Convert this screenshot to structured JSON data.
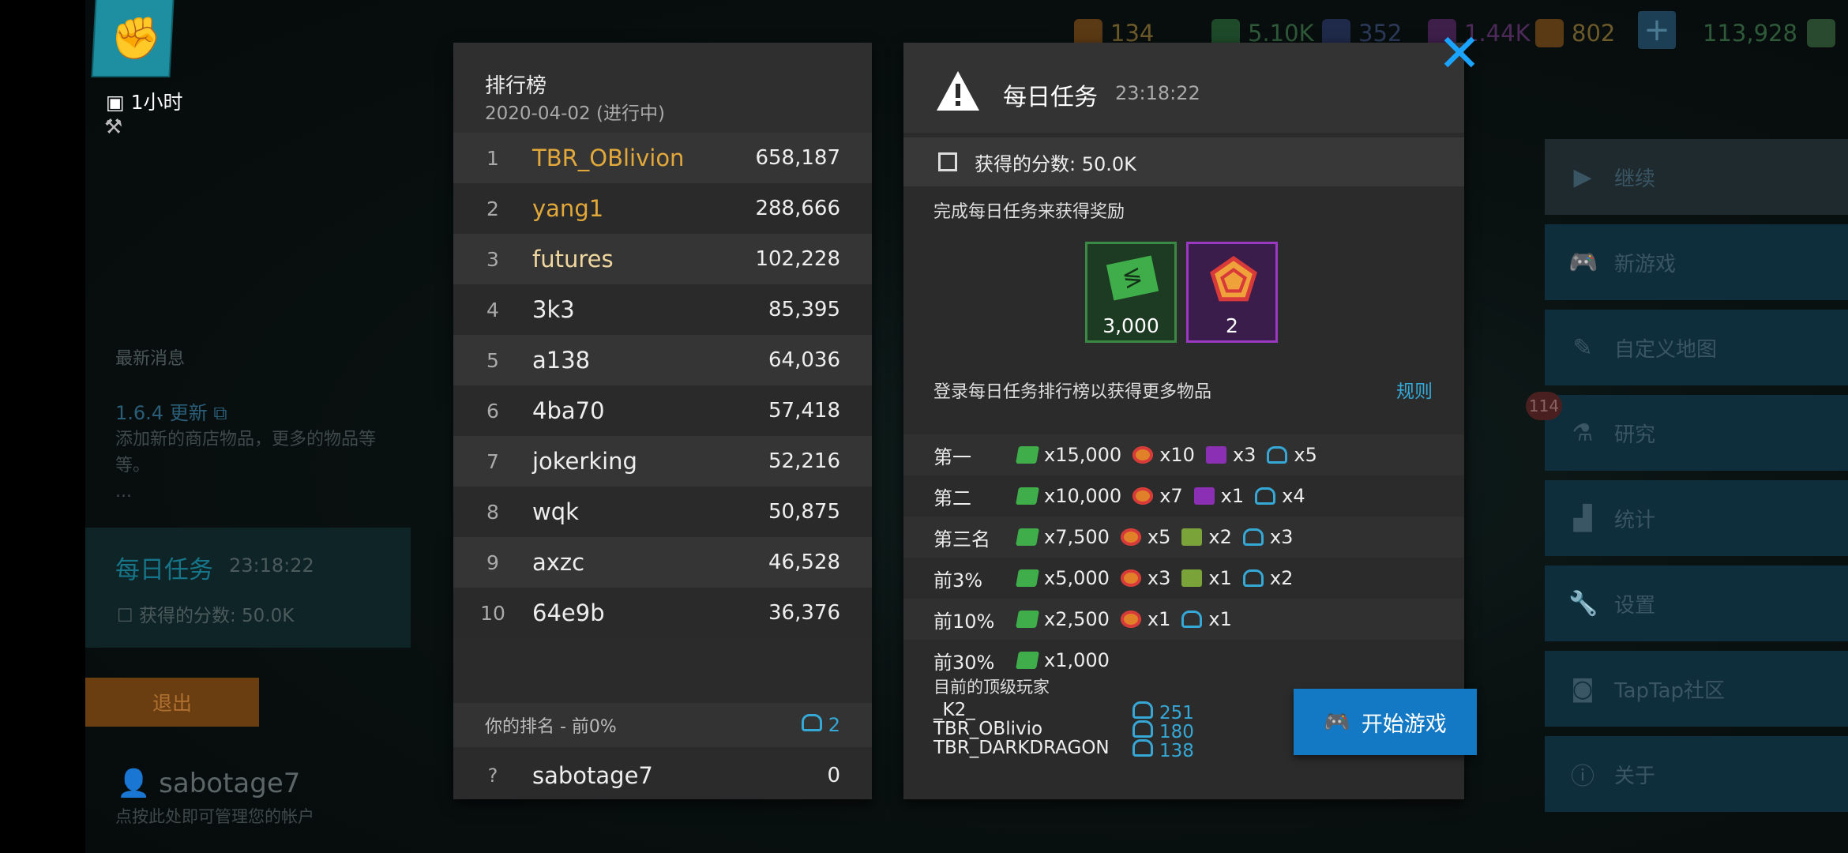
{
  "resources": {
    "r1": "134",
    "r2": "5.10K",
    "r3": "352",
    "r4": "1.44K",
    "r5": "802",
    "r6": "113,928"
  },
  "left": {
    "time": "1小时",
    "news_header": "最新消息",
    "news_update": "1.6.4 更新",
    "news_body": "添加新的商店物品，更多的物品等等。",
    "news_more": "...",
    "daily_title": "每日任务",
    "daily_time": "23:18:22",
    "daily_score": "获得的分数: 50.0K",
    "exit": "退出",
    "username": "sabotage7",
    "user_sub": "点按此处即可管理您的帐户"
  },
  "menu": {
    "continue": "继续",
    "new_game": "新游戏",
    "custom_map": "自定义地图",
    "research": "研究",
    "research_badge": "114",
    "stats": "统计",
    "settings": "设置",
    "taptap": "TapTap社区",
    "about": "关于"
  },
  "leaderboard": {
    "title": "排行榜",
    "date": "2020-04-02 (进行中)",
    "rows": [
      {
        "rank": "1",
        "name": "TBR_OBlivion",
        "score": "658,187"
      },
      {
        "rank": "2",
        "name": "yang1",
        "score": "288,666"
      },
      {
        "rank": "3",
        "name": "futures",
        "score": "102,228"
      },
      {
        "rank": "4",
        "name": "3k3",
        "score": "85,395"
      },
      {
        "rank": "5",
        "name": "a138",
        "score": "64,036"
      },
      {
        "rank": "6",
        "name": "4ba70",
        "score": "57,418"
      },
      {
        "rank": "7",
        "name": "jokerking",
        "score": "52,216"
      },
      {
        "rank": "8",
        "name": "wqk",
        "score": "50,875"
      },
      {
        "rank": "9",
        "name": "axzc",
        "score": "46,528"
      },
      {
        "rank": "10",
        "name": "64e9b",
        "score": "36,376"
      }
    ],
    "my_rank_label": "你的排名 - 前0%",
    "my_rank_value": "2",
    "me": {
      "rank": "?",
      "name": "sabotage7",
      "score": "0"
    }
  },
  "daily": {
    "title": "每日任务",
    "time": "23:18:22",
    "score": "获得的分数: 50.0K",
    "desc": "完成每日任务来获得奖励",
    "reward1": "3,000",
    "reward2": "2",
    "login": "登录每日任务排行榜以获得更多物品",
    "rules": "规则",
    "tiers": [
      {
        "name": "第一",
        "cash": "x15,000",
        "pent": "x10",
        "cube": "x3",
        "rank": "x5"
      },
      {
        "name": "第二",
        "cash": "x10,000",
        "pent": "x7",
        "cube": "x1",
        "rank": "x4"
      },
      {
        "name": "第三名",
        "cash": "x7,500",
        "pent": "x5",
        "cube": "x2",
        "rank": "x3"
      },
      {
        "name": "前3%",
        "cash": "x5,000",
        "pent": "x3",
        "cube": "x1",
        "rank": "x2"
      },
      {
        "name": "前10%",
        "cash": "x2,500",
        "pent": "x1",
        "rank": "x1"
      },
      {
        "name": "前30%",
        "cash": "x1,000"
      }
    ],
    "top_header": "目前的顶级玩家",
    "top_players": [
      {
        "name": "_K2_",
        "score": "251"
      },
      {
        "name": "TBR_OBlivio",
        "score": "180"
      },
      {
        "name": "TBR_DARKDRAGON",
        "score": "138"
      }
    ],
    "start": "开始游戏"
  },
  "colors": {
    "accent": "#1479c4",
    "gold": "#e2a83a",
    "rank_blue": "#35a8d6"
  }
}
